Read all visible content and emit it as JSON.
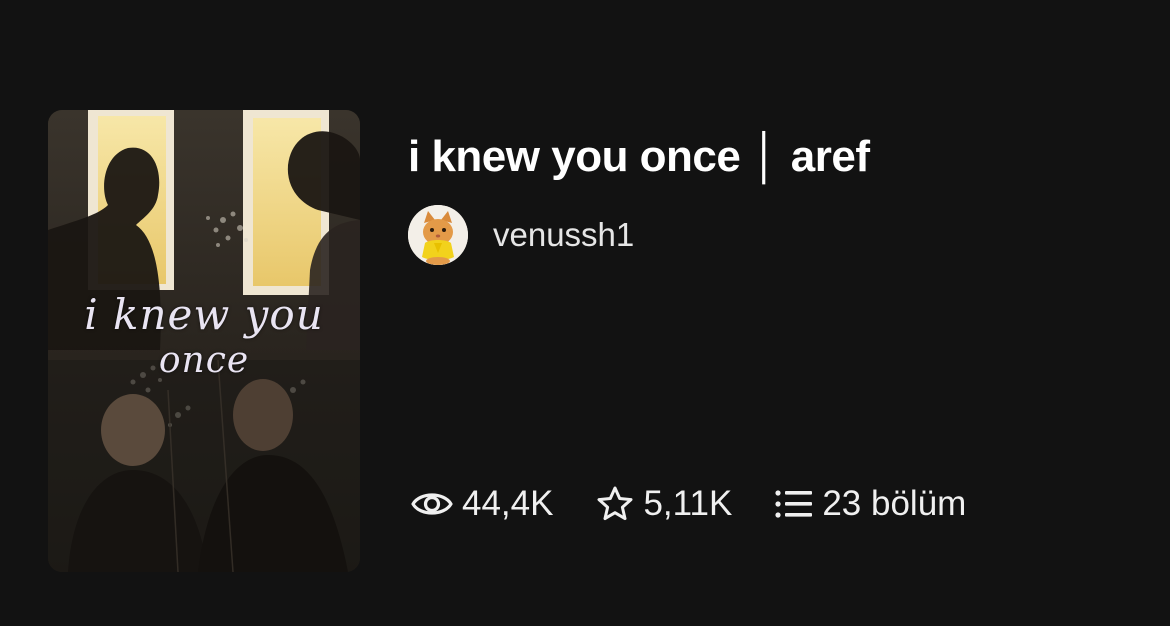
{
  "story": {
    "title": "i knew you once │ aref",
    "cover_title_line1": "i knew you",
    "cover_title_line2": "once"
  },
  "author": {
    "username": "venussh1",
    "avatar_icon": "cat-avatar-icon"
  },
  "stats": {
    "reads": "44,4K",
    "reads_icon": "eye-icon",
    "votes": "5,11K",
    "votes_icon": "star-icon",
    "parts": "23 bölüm",
    "parts_icon": "list-icon"
  },
  "colors": {
    "background": "#121212",
    "text": "#ffffff"
  }
}
